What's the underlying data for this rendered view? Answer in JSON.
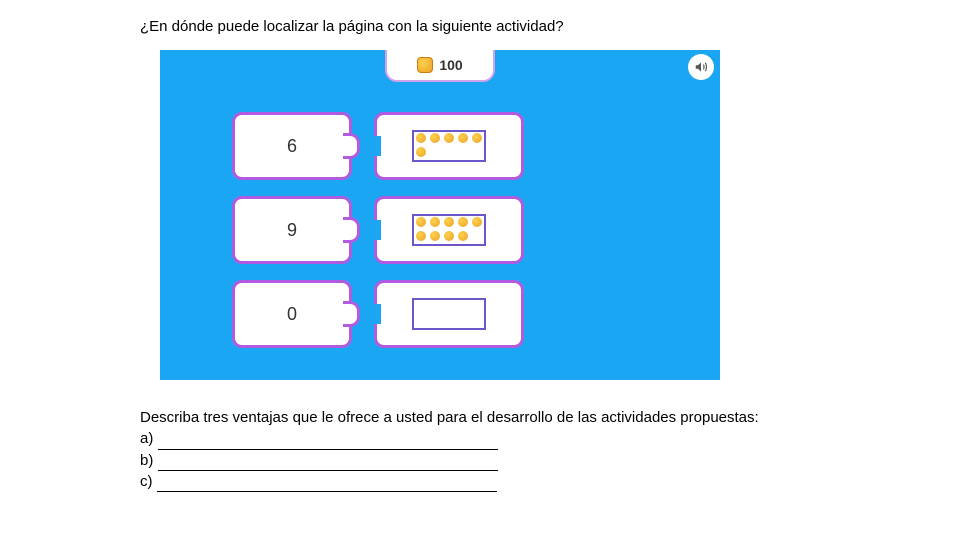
{
  "question": "¿En dónde puede localizar la página con la siguiente actividad?",
  "activity": {
    "score": "100",
    "rows": [
      {
        "number": "6",
        "dots": 6
      },
      {
        "number": "9",
        "dots": 9
      },
      {
        "number": "0",
        "dots": 0
      }
    ]
  },
  "prompt": "Describa tres ventajas que le ofrece a usted para el desarrollo de las actividades propuestas:",
  "answers": {
    "a": "a)",
    "b": "b)",
    "c": "c)"
  }
}
